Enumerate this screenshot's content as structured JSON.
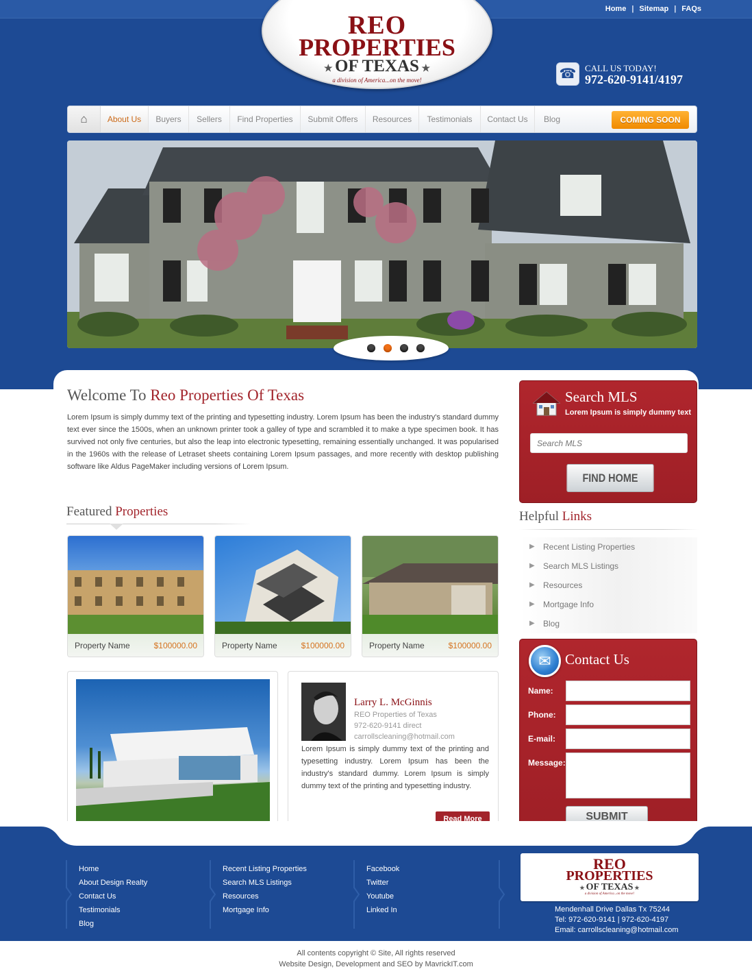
{
  "top_links": [
    "Home",
    "Sitemap",
    "FAQs"
  ],
  "top_sep": "|",
  "logo": {
    "line1": "REO",
    "line2": "PROPERTIES",
    "line3": "OF TEXAS",
    "tagline": "a division of America...on the move!"
  },
  "call": {
    "label": "CALL US TODAY!",
    "number": "972-620-9141/4197"
  },
  "nav": {
    "items": [
      "About Us",
      "Buyers",
      "Sellers",
      "Find Properties",
      "Submit Offers",
      "Resources",
      "Testimonials",
      "Contact Us",
      "Blog"
    ],
    "active": "About Us",
    "badge": "COMING SOON"
  },
  "slider": {
    "dots": 4,
    "active": 2
  },
  "welcome": {
    "title_a": "Welcome To",
    "title_b": "Reo Properties Of Texas",
    "body": "Lorem Ipsum is simply dummy text of the printing and typesetting industry. Lorem Ipsum has been the industry's standard dummy text ever since the 1500s, when an unknown printer took a galley of type and scrambled it to make a type specimen book. It has survived not only five centuries, but also the leap into electronic typesetting, remaining essentially unchanged. It was popularised in the 1960s with the release of Letraset sheets containing Lorem Ipsum passages, and more recently with desktop publishing software like Aldus PageMaker including versions of Lorem Ipsum."
  },
  "featured": {
    "title_a": "Featured",
    "title_b": "Properties",
    "items": [
      {
        "name": "Property Name",
        "price": "$100000.00"
      },
      {
        "name": "Property Name",
        "price": "$100000.00"
      },
      {
        "name": "Property Name",
        "price": "$100000.00"
      }
    ]
  },
  "agent": {
    "name": "Larry L. McGinnis",
    "company": "REO Properties of Texas",
    "phone": "972-620-9141 direct",
    "email": "carrollscleaning@hotmail.com",
    "body": "Lorem Ipsum is simply dummy text of the printing and typesetting industry. Lorem Ipsum has been the industry's standard dummy. Lorem Ipsum is simply dummy text of the printing and typesetting industry.",
    "read_more": "Read More"
  },
  "search_mls": {
    "title": "Search MLS",
    "subtitle": "Lorem Ipsum is simply dummy text",
    "placeholder": "Search MLS",
    "button": "FIND HOME"
  },
  "helpful": {
    "title_a": "Helpful",
    "title_b": "Links",
    "items": [
      "Recent Listing Properties",
      "Search MLS Listings",
      "Resources",
      "Mortgage Info",
      "Blog"
    ]
  },
  "contact": {
    "title": "Contact Us",
    "labels": [
      "Name:",
      "Phone:",
      "E-mail:",
      "Message:"
    ],
    "button": "SUBMIT"
  },
  "footer": {
    "col1": [
      "Home",
      "About Design Realty",
      "Contact Us",
      "Testimonials",
      "Blog"
    ],
    "col2": [
      "Recent Listing Properties",
      "Search MLS Listings",
      "Resources",
      "Mortgage Info"
    ],
    "col3": [
      "Facebook",
      "Twitter",
      "Youtube",
      "Linked In"
    ],
    "address": "Mendenhall Drive Dallas Tx 75244",
    "tel": "Tel: 972-620-9141 | 972-620-4197",
    "email": "Email: carrollscleaning@hotmail.com"
  },
  "copyright": {
    "line1": "All contents copyright © Site, All rights reserved",
    "line2": "Website Design, Development and SEO by MavrickIT.com"
  },
  "colors": {
    "blue": "#1d4a94",
    "red": "#a2242b",
    "orange": "#f08a00"
  }
}
